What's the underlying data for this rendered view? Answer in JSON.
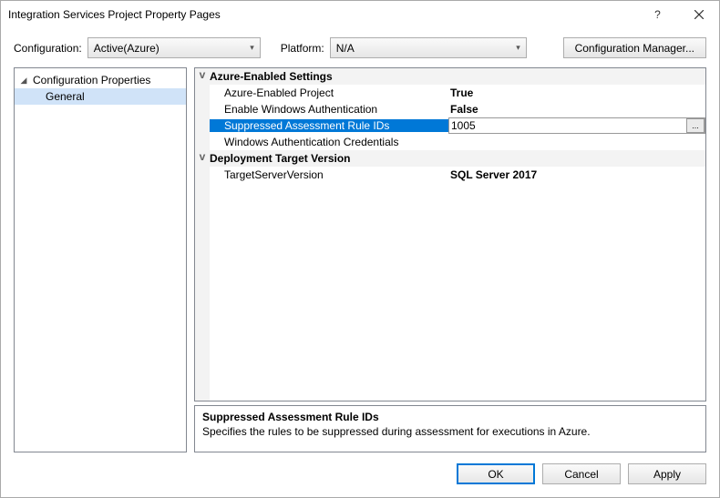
{
  "titlebar": {
    "title": "Integration Services Project Property Pages"
  },
  "configrow": {
    "config_label": "Configuration:",
    "config_value": "Active(Azure)",
    "platform_label": "Platform:",
    "platform_value": "N/A",
    "manager_button": "Configuration Manager..."
  },
  "tree": {
    "root": "Configuration Properties",
    "child": "General"
  },
  "grid": {
    "cat_azure": "Azure-Enabled Settings",
    "r1_name": "Azure-Enabled Project",
    "r1_val": "True",
    "r2_name": "Enable Windows Authentication",
    "r2_val": "False",
    "r3_name": "Suppressed Assessment Rule IDs",
    "r3_val": "1005",
    "r4_name": "Windows Authentication Credentials",
    "r4_val": "",
    "cat_deploy": "Deployment Target Version",
    "r5_name": "TargetServerVersion",
    "r5_val": "SQL Server 2017",
    "ellipsis": "..."
  },
  "desc": {
    "title": "Suppressed Assessment Rule IDs",
    "text": "Specifies the rules to be suppressed during assessment for executions in Azure."
  },
  "buttons": {
    "ok": "OK",
    "cancel": "Cancel",
    "apply": "Apply"
  }
}
